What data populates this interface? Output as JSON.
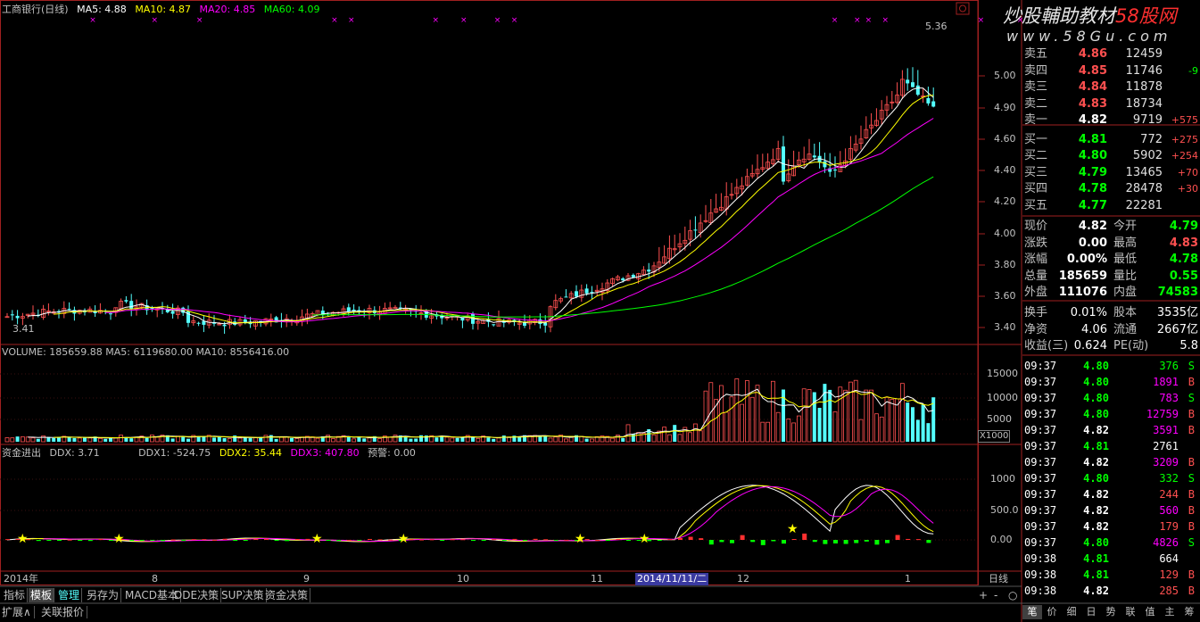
{
  "header": {
    "title": "工商银行(日线)",
    "ma5": "MA5: 4.88",
    "ma10": "MA10: 4.87",
    "ma20": "MA20: 4.85",
    "ma60": "MA60: 4.09",
    "peak_label": "5.36",
    "low_label": "3.41"
  },
  "watermark": {
    "line1": "炒股輔助教材",
    "brand": "58股网",
    "line2": "www.58Gu.com"
  },
  "price_axis": [
    "5.00",
    "4.90",
    "4.60",
    "4.40",
    "4.20",
    "4.00",
    "3.80",
    "3.60",
    "3.40"
  ],
  "volume": {
    "header": "VOLUME: 185659.88  MA5: 6119680.00  MA10: 8556416.00",
    "axis": [
      "15000",
      "10000",
      "5000"
    ],
    "unit": "X1000"
  },
  "ddx": {
    "title": "资金进出",
    "ddx": "DDX: 3.71",
    "ddx1": "DDX1: -524.75",
    "ddx2": "DDX2: 35.44",
    "ddx3": "DDX3: 407.80",
    "warn": "预警: 0.00",
    "axis": [
      "1000",
      "500.0",
      "0.00"
    ]
  },
  "time_axis": {
    "labels": [
      "2014年",
      "8",
      "9",
      "10",
      "11",
      "2014/11/11/二",
      "12",
      "1"
    ],
    "period": "日线"
  },
  "bottom_tabs": [
    "指标",
    "模板",
    "管理",
    "另存为",
    "MACD基本",
    "DDE决策",
    "SUP决策",
    "资金决策"
  ],
  "bottom_tabs2": [
    "扩展∧",
    "关联报价"
  ],
  "zoom_controls": [
    "+",
    "-",
    "○"
  ],
  "order_book": [
    {
      "label": "卖五",
      "price": "4.86",
      "vol": "12459",
      "chg": ""
    },
    {
      "label": "卖四",
      "price": "4.85",
      "vol": "11746",
      "chg": "-9"
    },
    {
      "label": "卖三",
      "price": "4.84",
      "vol": "11878",
      "chg": ""
    },
    {
      "label": "卖二",
      "price": "4.83",
      "vol": "18734",
      "chg": ""
    },
    {
      "label": "卖一",
      "price": "4.82",
      "vol": "9719",
      "chg": "+575"
    },
    {
      "label": "买一",
      "price": "4.81",
      "vol": "772",
      "chg": "+275"
    },
    {
      "label": "买二",
      "price": "4.80",
      "vol": "5902",
      "chg": "+254"
    },
    {
      "label": "买三",
      "price": "4.79",
      "vol": "13465",
      "chg": "+70"
    },
    {
      "label": "买四",
      "price": "4.78",
      "vol": "28478",
      "chg": "+30"
    },
    {
      "label": "买五",
      "price": "4.77",
      "vol": "22281",
      "chg": ""
    }
  ],
  "stats": [
    {
      "l1": "现价",
      "v1": "4.82",
      "l2": "今开",
      "v2": "4.79"
    },
    {
      "l1": "涨跌",
      "v1": "0.00",
      "l2": "最高",
      "v2": "4.83"
    },
    {
      "l1": "涨幅",
      "v1": "0.00%",
      "l2": "最低",
      "v2": "4.78"
    },
    {
      "l1": "总量",
      "v1": "185659",
      "l2": "量比",
      "v2": "0.55"
    },
    {
      "l1": "外盘",
      "v1": "111076",
      "l2": "内盘",
      "v2": "74583"
    }
  ],
  "stats2": [
    {
      "l1": "换手",
      "v1": "0.01%",
      "l2": "股本",
      "v2": "3535亿"
    },
    {
      "l1": "净资",
      "v1": "4.06",
      "l2": "流通",
      "v2": "2667亿"
    },
    {
      "l1": "收益(三)",
      "v1": "0.624",
      "l2": "PE(动)",
      "v2": "5.8"
    }
  ],
  "ticks": [
    {
      "t": "09:37",
      "p": "4.80",
      "v": "376",
      "d": "S"
    },
    {
      "t": "09:37",
      "p": "4.80",
      "v": "1891",
      "d": "B"
    },
    {
      "t": "09:37",
      "p": "4.80",
      "v": "783",
      "d": "S"
    },
    {
      "t": "09:37",
      "p": "4.80",
      "v": "12759",
      "d": "B"
    },
    {
      "t": "09:37",
      "p": "4.82",
      "v": "3591",
      "d": "B"
    },
    {
      "t": "09:37",
      "p": "4.81",
      "v": "2761",
      "d": ""
    },
    {
      "t": "09:37",
      "p": "4.82",
      "v": "3209",
      "d": "B"
    },
    {
      "t": "09:37",
      "p": "4.80",
      "v": "332",
      "d": "S"
    },
    {
      "t": "09:37",
      "p": "4.82",
      "v": "244",
      "d": "B"
    },
    {
      "t": "09:37",
      "p": "4.82",
      "v": "560",
      "d": "B"
    },
    {
      "t": "09:37",
      "p": "4.82",
      "v": "179",
      "d": "B"
    },
    {
      "t": "09:37",
      "p": "4.80",
      "v": "4826",
      "d": "S"
    },
    {
      "t": "09:38",
      "p": "4.81",
      "v": "664",
      "d": ""
    },
    {
      "t": "09:38",
      "p": "4.81",
      "v": "129",
      "d": "B"
    },
    {
      "t": "09:38",
      "p": "4.82",
      "v": "285",
      "d": "B"
    }
  ],
  "right_tabs": [
    "笔",
    "价",
    "细",
    "日",
    "势",
    "联",
    "值",
    "主",
    "筹"
  ],
  "colors": {
    "up": "#ff5050",
    "down": "#54ffff",
    "ma5": "#ffffff",
    "ma10": "#ffff00",
    "ma20": "#ff00ff",
    "ma60": "#00ff00",
    "panel_border": "#a02020"
  }
}
